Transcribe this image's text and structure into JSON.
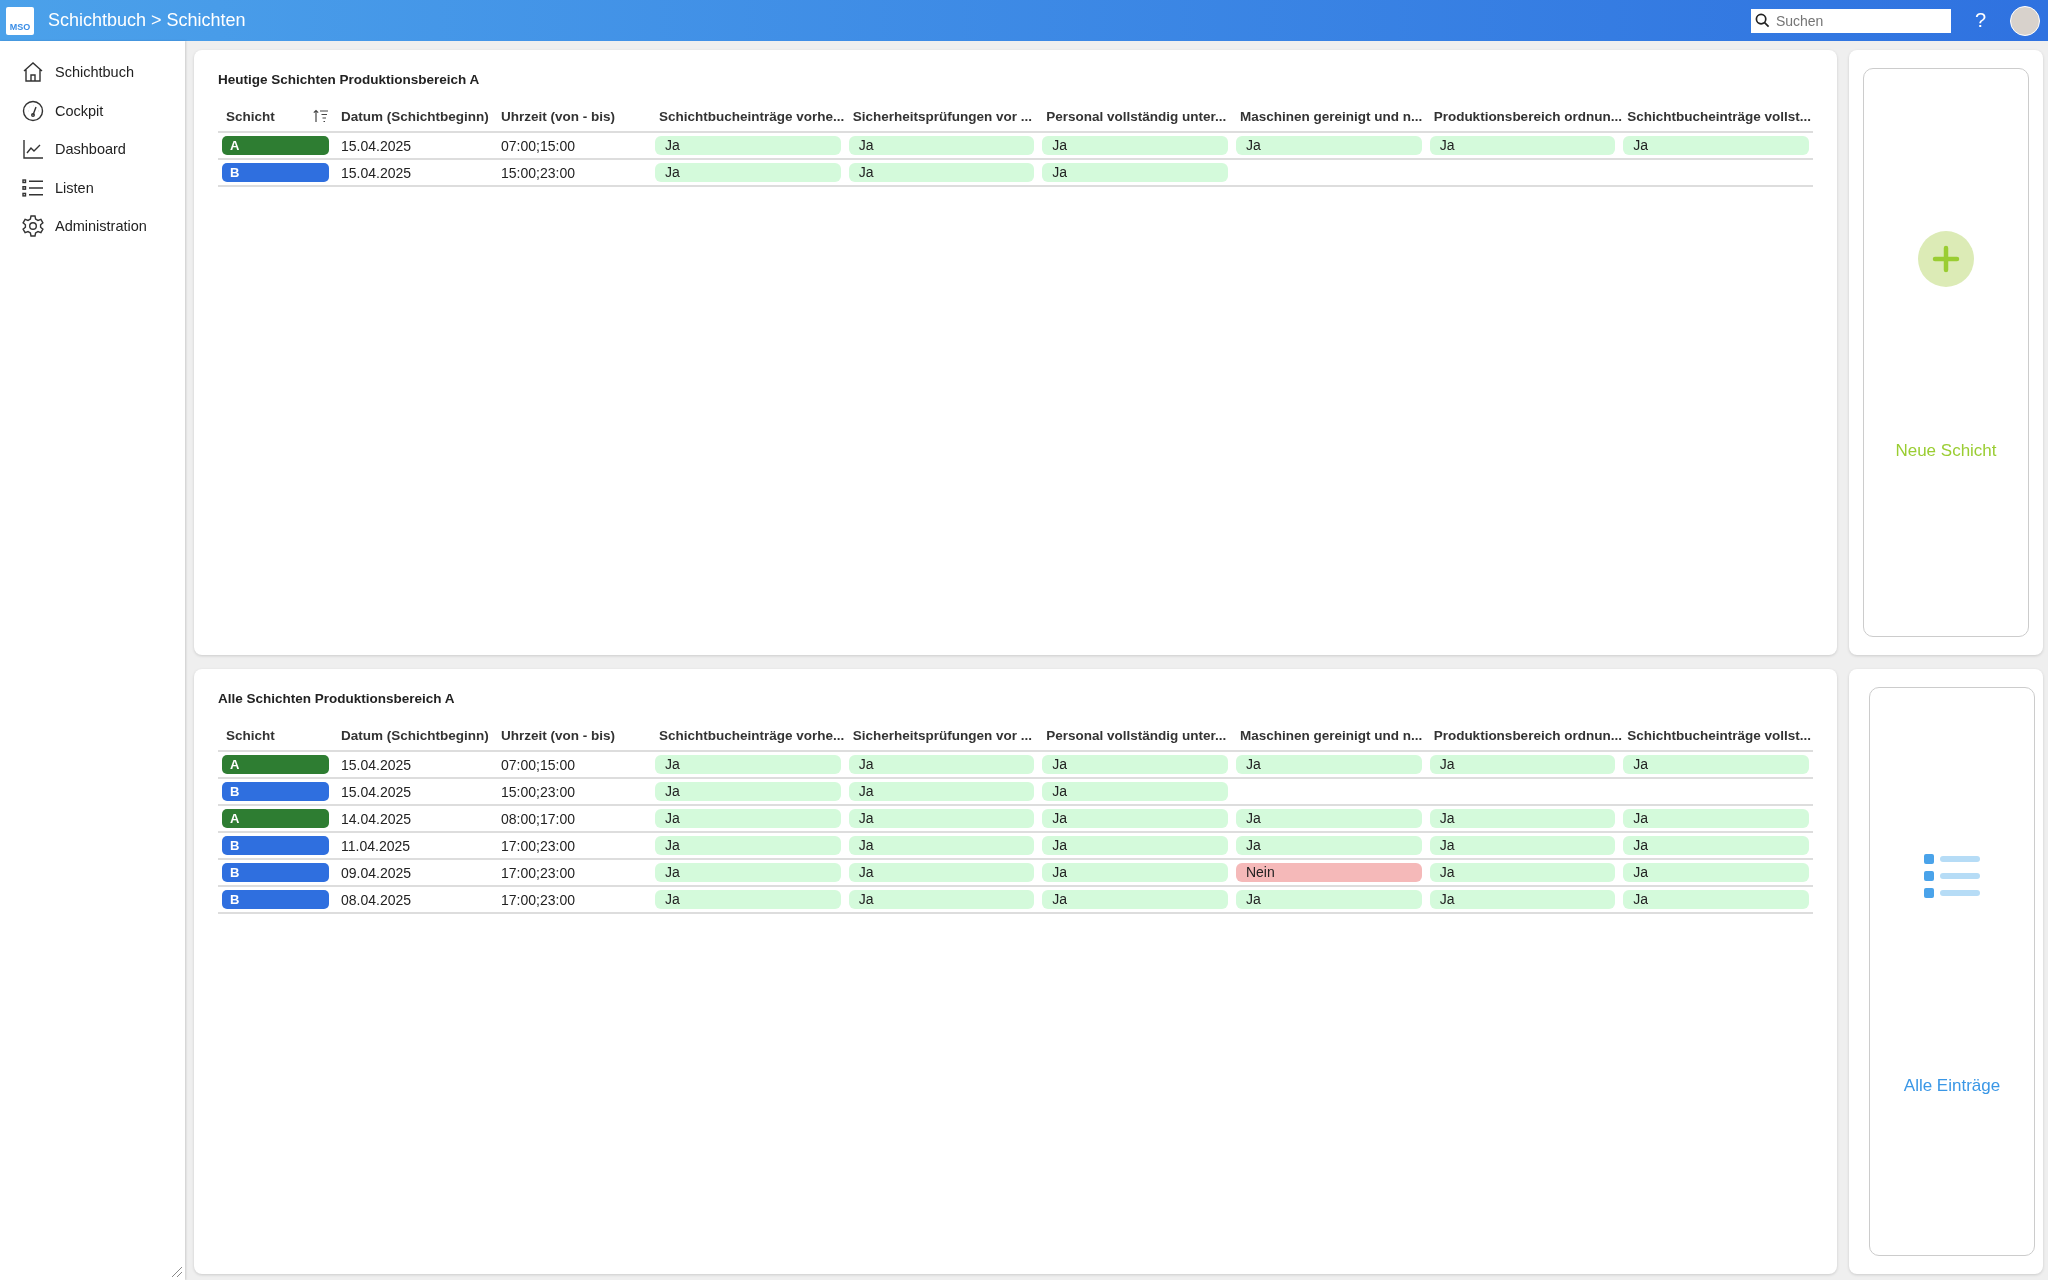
{
  "header": {
    "logo": "MSO",
    "title": "Schichtbuch > Schichten",
    "search": {
      "placeholder": "Suchen"
    },
    "help": "?"
  },
  "sidebar": {
    "items": [
      {
        "label": "Schichtbuch",
        "kind": "home"
      },
      {
        "label": "Cockpit",
        "kind": "gauge"
      },
      {
        "label": "Dashboard",
        "kind": "chart"
      },
      {
        "label": "Listen",
        "kind": "list"
      },
      {
        "label": "Administration",
        "kind": "gear"
      }
    ]
  },
  "panels": [
    {
      "title": "Heutige Schichten Produktionsbereich A",
      "columns": [
        {
          "label": "Schicht",
          "sorted": true
        },
        {
          "label": "Datum (Schichtbeginn)",
          "sorted": false
        },
        {
          "label": "Uhrzeit (von - bis)",
          "sorted": false
        },
        {
          "label": "Schichtbucheinträge vorhe...",
          "sorted": false
        },
        {
          "label": "Sicherheitsprüfungen vor ...",
          "sorted": false
        },
        {
          "label": "Personal vollständig unter...",
          "sorted": false
        },
        {
          "label": "Maschinen gereinigt und n...",
          "sorted": false
        },
        {
          "label": "Produktionsbereich ordnun...",
          "sorted": false
        },
        {
          "label": "Schichtbucheinträge vollst...",
          "sorted": false
        }
      ],
      "rows": [
        {
          "shift": "A",
          "color": "#2e7d32",
          "date": "15.04.2025",
          "time": "07:00;15:00",
          "checks": [
            {
              "value": "Ja",
              "kind": "yes"
            },
            {
              "value": "Ja",
              "kind": "yes"
            },
            {
              "value": "Ja",
              "kind": "yes"
            },
            {
              "value": "Ja",
              "kind": "yes"
            },
            {
              "value": "Ja",
              "kind": "yes"
            },
            {
              "value": "Ja",
              "kind": "yes"
            }
          ]
        },
        {
          "shift": "B",
          "color": "#2f6fdf",
          "date": "15.04.2025",
          "time": "15:00;23:00",
          "checks": [
            {
              "value": "Ja",
              "kind": "yes"
            },
            {
              "value": "Ja",
              "kind": "yes"
            },
            {
              "value": "Ja",
              "kind": "yes"
            }
          ]
        }
      ],
      "action": {
        "label": "Neue Schicht",
        "kind": "add"
      }
    },
    {
      "title": "Alle Schichten Produktionsbereich A",
      "columns": [
        {
          "label": "Schicht",
          "sorted": false
        },
        {
          "label": "Datum (Schichtbeginn)",
          "sorted": false
        },
        {
          "label": "Uhrzeit (von - bis)",
          "sorted": false
        },
        {
          "label": "Schichtbucheinträge vorhe...",
          "sorted": false
        },
        {
          "label": "Sicherheitsprüfungen vor ...",
          "sorted": false
        },
        {
          "label": "Personal vollständig unter...",
          "sorted": false
        },
        {
          "label": "Maschinen gereinigt und n...",
          "sorted": false
        },
        {
          "label": "Produktionsbereich ordnun...",
          "sorted": false
        },
        {
          "label": "Schichtbucheinträge vollst...",
          "sorted": false
        }
      ],
      "rows": [
        {
          "shift": "A",
          "color": "#2e7d32",
          "date": "15.04.2025",
          "time": "07:00;15:00",
          "checks": [
            {
              "value": "Ja",
              "kind": "yes"
            },
            {
              "value": "Ja",
              "kind": "yes"
            },
            {
              "value": "Ja",
              "kind": "yes"
            },
            {
              "value": "Ja",
              "kind": "yes"
            },
            {
              "value": "Ja",
              "kind": "yes"
            },
            {
              "value": "Ja",
              "kind": "yes"
            }
          ]
        },
        {
          "shift": "B",
          "color": "#2f6fdf",
          "date": "15.04.2025",
          "time": "15:00;23:00",
          "checks": [
            {
              "value": "Ja",
              "kind": "yes"
            },
            {
              "value": "Ja",
              "kind": "yes"
            },
            {
              "value": "Ja",
              "kind": "yes"
            }
          ]
        },
        {
          "shift": "A",
          "color": "#2e7d32",
          "date": "14.04.2025",
          "time": "08:00;17:00",
          "checks": [
            {
              "value": "Ja",
              "kind": "yes"
            },
            {
              "value": "Ja",
              "kind": "yes"
            },
            {
              "value": "Ja",
              "kind": "yes"
            },
            {
              "value": "Ja",
              "kind": "yes"
            },
            {
              "value": "Ja",
              "kind": "yes"
            },
            {
              "value": "Ja",
              "kind": "yes"
            }
          ]
        },
        {
          "shift": "B",
          "color": "#2f6fdf",
          "date": "11.04.2025",
          "time": "17:00;23:00",
          "checks": [
            {
              "value": "Ja",
              "kind": "yes"
            },
            {
              "value": "Ja",
              "kind": "yes"
            },
            {
              "value": "Ja",
              "kind": "yes"
            },
            {
              "value": "Ja",
              "kind": "yes"
            },
            {
              "value": "Ja",
              "kind": "yes"
            },
            {
              "value": "Ja",
              "kind": "yes"
            }
          ]
        },
        {
          "shift": "B",
          "color": "#2f6fdf",
          "date": "09.04.2025",
          "time": "17:00;23:00",
          "checks": [
            {
              "value": "Ja",
              "kind": "yes"
            },
            {
              "value": "Ja",
              "kind": "yes"
            },
            {
              "value": "Ja",
              "kind": "yes"
            },
            {
              "value": "Nein",
              "kind": "no"
            },
            {
              "value": "Ja",
              "kind": "yes"
            },
            {
              "value": "Ja",
              "kind": "yes"
            }
          ]
        },
        {
          "shift": "B",
          "color": "#2f6fdf",
          "date": "08.04.2025",
          "time": "17:00;23:00",
          "checks": [
            {
              "value": "Ja",
              "kind": "yes"
            },
            {
              "value": "Ja",
              "kind": "yes"
            },
            {
              "value": "Ja",
              "kind": "yes"
            },
            {
              "value": "Ja",
              "kind": "yes"
            },
            {
              "value": "Ja",
              "kind": "yes"
            },
            {
              "value": "Ja",
              "kind": "yes"
            }
          ]
        }
      ],
      "action": {
        "label": "Alle Einträge",
        "kind": "list"
      }
    }
  ]
}
